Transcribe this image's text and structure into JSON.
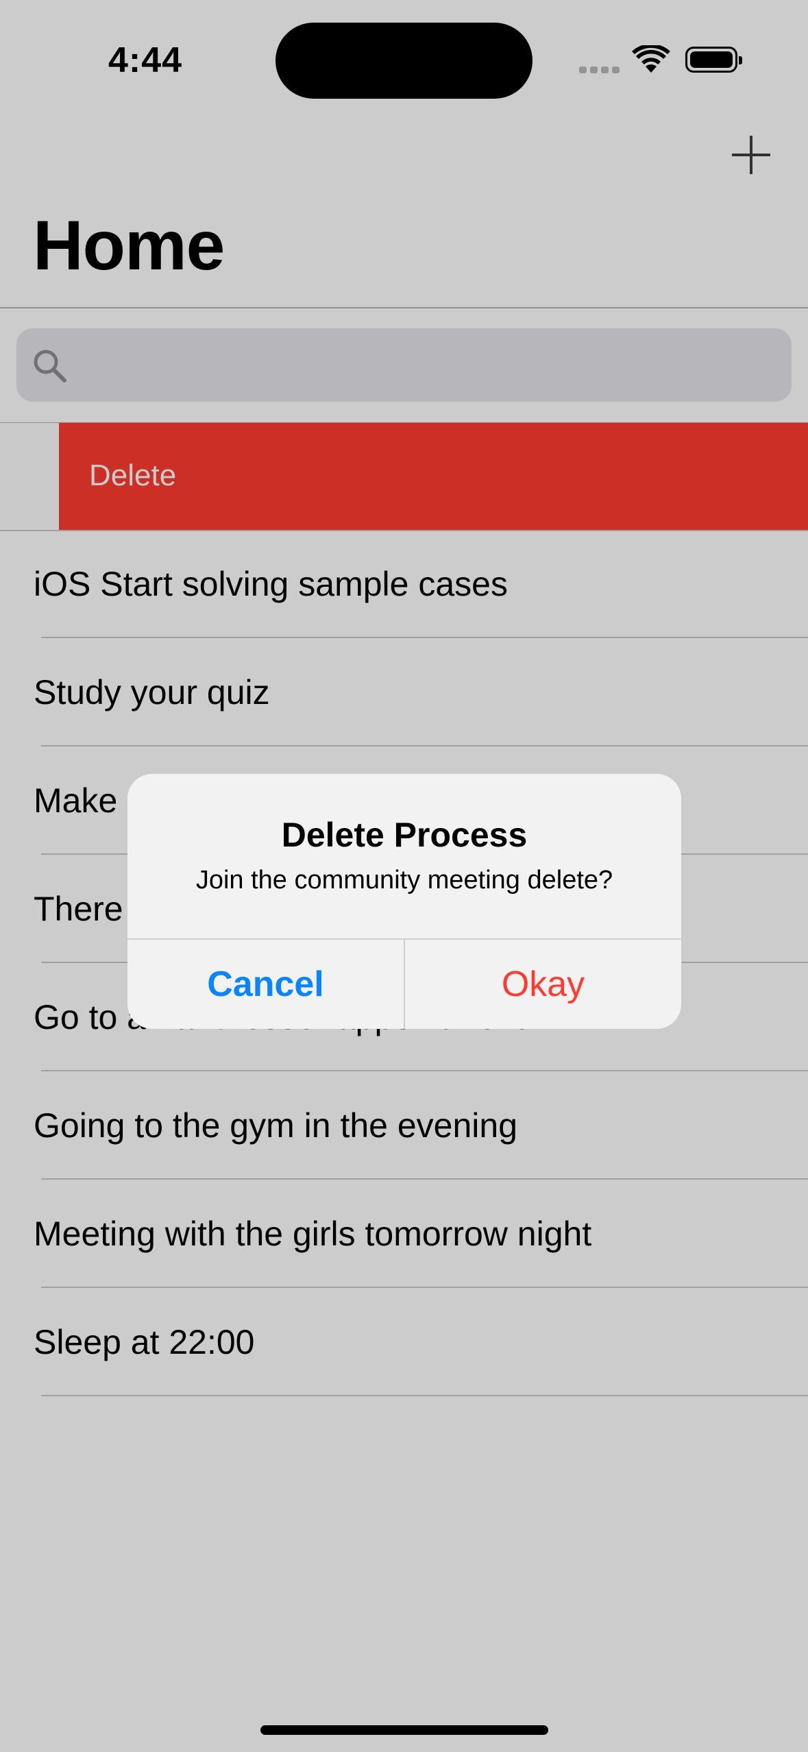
{
  "status_bar": {
    "time": "4:44"
  },
  "nav": {
    "title": "Home"
  },
  "search": {
    "placeholder": ""
  },
  "swipe_action": {
    "label": "Delete"
  },
  "tasks": [
    "iOS Start solving sample cases",
    "Study your quiz",
    "Make",
    "There",
    "Go to a hairdresser appointment",
    "Going to the gym in the evening",
    "Meeting with the girls tomorrow night",
    "Sleep at 22:00"
  ],
  "alert": {
    "title": "Delete Process",
    "message": "Join the community meeting delete?",
    "cancel_label": "Cancel",
    "okay_label": "Okay"
  },
  "colors": {
    "destructive": "#ff3b30",
    "accent": "#0a84ff"
  }
}
